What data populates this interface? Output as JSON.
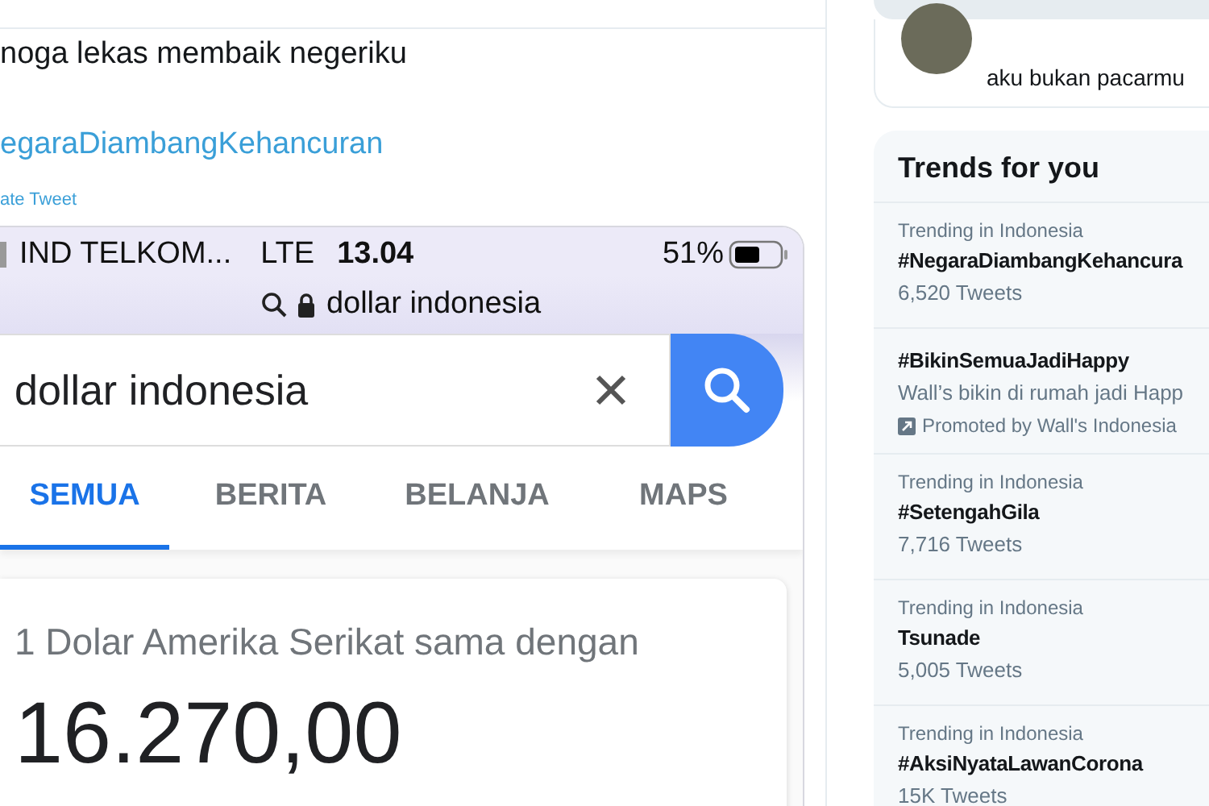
{
  "tweet": {
    "text": "noga lekas membaik negeriku",
    "hashtag": "egaraDiambangKehancuran",
    "link": "ate Tweet"
  },
  "phone_screenshot": {
    "status_bar": {
      "carrier": "IND TELKOM...",
      "network": "LTE",
      "time": "13.04",
      "battery": "51%"
    },
    "address": "dollar indonesia",
    "search": {
      "value": "dollar indonesia"
    },
    "tabs": [
      {
        "label": "SEMUA",
        "selected": true
      },
      {
        "label": "BERITA",
        "selected": false
      },
      {
        "label": "BELANJA",
        "selected": false
      },
      {
        "label": "MAPS",
        "selected": false
      }
    ],
    "result": {
      "caption": "1 Dolar Amerika Serikat sama dengan",
      "amount": "16.270,00"
    }
  },
  "sidebar": {
    "profile_card": {
      "bio": "aku bukan pacarmu"
    },
    "trends": {
      "title": "Trends for you",
      "items": [
        {
          "kind": "trend",
          "context": "Trending in Indonesia",
          "name": "#NegaraDiambangKehancura",
          "count": "6,520 Tweets"
        },
        {
          "kind": "promoted",
          "name": "#BikinSemuaJadiHappy",
          "description": "Wall’s bikin di rumah jadi Happ",
          "promoted_by": "Promoted by Wall's Indonesia"
        },
        {
          "kind": "trend",
          "context": "Trending in Indonesia",
          "name": "#SetengahGila",
          "count": "7,716 Tweets"
        },
        {
          "kind": "trend",
          "context": "Trending in Indonesia",
          "name": "Tsunade",
          "count": "5,005 Tweets"
        },
        {
          "kind": "trend",
          "context": "Trending in Indonesia",
          "name": "#AksiNyataLawanCorona",
          "count": "15K Tweets"
        }
      ]
    }
  }
}
